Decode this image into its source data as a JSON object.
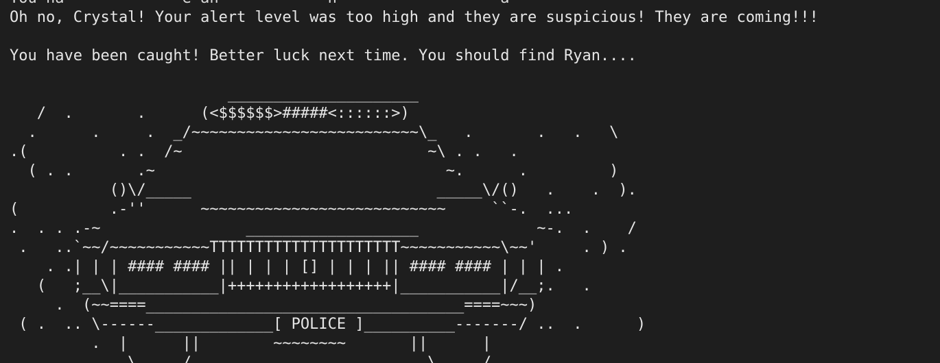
{
  "terminal": {
    "partial_line": "You ha             e an            h                  a",
    "alert_line": "Oh no, Crystal! Your alert level was too high and they are suspicious! They are coming!!!",
    "blank_1": "",
    "caught_line": "You have been caught! Better luck next time. You should find Ryan....",
    "blank_2": "",
    "art": [
      "                        _____________________",
      "   /  .       .      (<$$$$$$>#####<::::::>)",
      "  .      .     .  _/~~~~~~~~~~~~~~~~~~~~~~~~~\\_   .       .   .   \\",
      ".(          . .  /~                           ~\\ . .   .",
      "  ( . .       .~                                ~.      .         )",
      "           ()\\/_____                           _____\\/()   .    .  ).",
      "(          .-''      ~~~~~~~~~~~~~~~~~~~~~~~~~~~     ``-.  ...",
      ".  . . .-~                ___________________             ~-.  .    /",
      " .   ..`~~/~~~~~~~~~~~TTTTTTTTTTTTTTTTTTTTT~~~~~~~~~~~\\~~'     . ) .",
      "    . .| | | #### #### || | | | [] | | | || #### #### | | | .",
      "   (   ;__\\|___________|++++++++++++++++++|___________|/__;.   .",
      "     .  (~~====___________________________________====~~~)",
      " ( .  .. \\------_____________[ POLICE ]__________-------/ ..  .      )",
      "         .  |      ||        ~~~~~~~~       ||      |",
      "             \\     /                          \\     /"
    ]
  }
}
